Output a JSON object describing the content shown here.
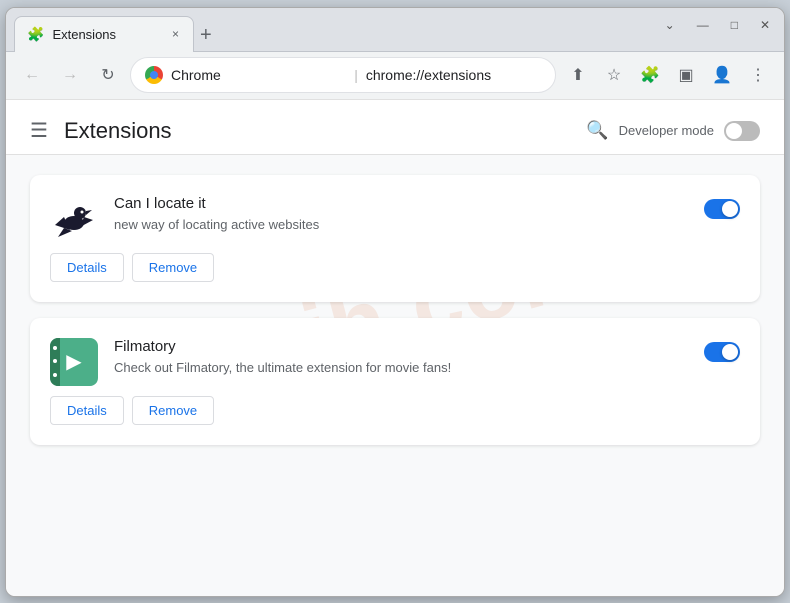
{
  "window": {
    "title": "Extensions",
    "tab_close": "×",
    "new_tab": "+",
    "controls": {
      "minimize": "—",
      "maximize": "□",
      "close": "✕",
      "dropdown": "⌄"
    }
  },
  "toolbar": {
    "back_label": "←",
    "forward_label": "→",
    "refresh_label": "↻",
    "chrome_label": "Chrome",
    "address": "chrome://extensions",
    "separator": "|"
  },
  "page": {
    "title": "Extensions",
    "developer_mode_label": "Developer mode"
  },
  "extensions": [
    {
      "id": "can-locate-it",
      "name": "Can I locate it",
      "description": "new way of locating active websites",
      "details_label": "Details",
      "remove_label": "Remove",
      "enabled": true
    },
    {
      "id": "filmatory",
      "name": "Filmatory",
      "description": "Check out Filmatory, the ultimate extension for movie fans!",
      "details_label": "Details",
      "remove_label": "Remove",
      "enabled": true
    }
  ],
  "watermark": {
    "text": "riajh.com"
  }
}
